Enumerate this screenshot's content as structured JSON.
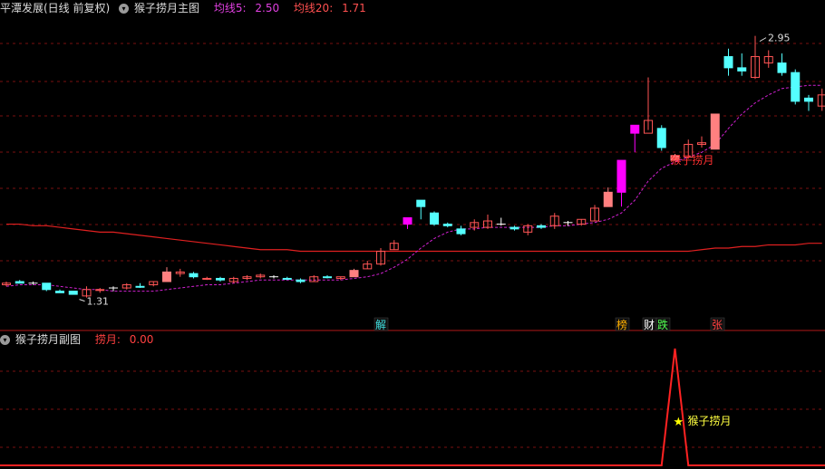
{
  "header_main": {
    "stock": "平潭发展(日线 前复权)",
    "indicator": "猴子捞月主图",
    "ma5_label": "均线5:",
    "ma5_value": "2.50",
    "ma20_label": "均线20:",
    "ma20_value": "1.71"
  },
  "header_sub": {
    "indicator": "猴子捞月副图",
    "value_label": "捞月:",
    "value": "0.00"
  },
  "colors": {
    "up_hollow": "#ff5555",
    "up_fill": "#ff8080",
    "down": "#54ffff",
    "limit_up": "#ff00ff",
    "ma5": "#d020d0",
    "ma20": "#e02020",
    "grid": "#7a1010",
    "signal": "#ff2222",
    "star": "#ffff00"
  },
  "chart_data": [
    {
      "type": "candlestick",
      "ylim": [
        1.2,
        3.05
      ],
      "candles": [
        {
          "o": 1.4,
          "h": 1.41,
          "l": 1.38,
          "c": 1.39,
          "t": "up"
        },
        {
          "o": 1.41,
          "h": 1.42,
          "l": 1.4,
          "c": 1.4,
          "t": "down"
        },
        {
          "o": 1.4,
          "h": 1.41,
          "l": 1.39,
          "c": 1.4,
          "t": "doji"
        },
        {
          "o": 1.4,
          "h": 1.4,
          "l": 1.35,
          "c": 1.36,
          "t": "down"
        },
        {
          "o": 1.35,
          "h": 1.36,
          "l": 1.34,
          "c": 1.34,
          "t": "down"
        },
        {
          "o": 1.35,
          "h": 1.35,
          "l": 1.33,
          "c": 1.33,
          "t": "down"
        },
        {
          "o": 1.32,
          "h": 1.38,
          "l": 1.31,
          "c": 1.36,
          "t": "up"
        },
        {
          "o": 1.36,
          "h": 1.37,
          "l": 1.34,
          "c": 1.36,
          "t": "up"
        },
        {
          "o": 1.37,
          "h": 1.38,
          "l": 1.35,
          "c": 1.37,
          "t": "doji"
        },
        {
          "o": 1.37,
          "h": 1.4,
          "l": 1.36,
          "c": 1.39,
          "t": "up"
        },
        {
          "o": 1.38,
          "h": 1.4,
          "l": 1.37,
          "c": 1.38,
          "t": "down"
        },
        {
          "o": 1.39,
          "h": 1.41,
          "l": 1.38,
          "c": 1.41,
          "t": "up"
        },
        {
          "o": 1.41,
          "h": 1.5,
          "l": 1.41,
          "c": 1.47,
          "t": "upfill"
        },
        {
          "o": 1.46,
          "h": 1.49,
          "l": 1.44,
          "c": 1.47,
          "t": "up"
        },
        {
          "o": 1.46,
          "h": 1.47,
          "l": 1.43,
          "c": 1.44,
          "t": "down"
        },
        {
          "o": 1.43,
          "h": 1.44,
          "l": 1.42,
          "c": 1.43,
          "t": "up"
        },
        {
          "o": 1.43,
          "h": 1.44,
          "l": 1.41,
          "c": 1.42,
          "t": "down"
        },
        {
          "o": 1.41,
          "h": 1.44,
          "l": 1.4,
          "c": 1.43,
          "t": "up"
        },
        {
          "o": 1.43,
          "h": 1.45,
          "l": 1.42,
          "c": 1.44,
          "t": "up"
        },
        {
          "o": 1.44,
          "h": 1.46,
          "l": 1.43,
          "c": 1.45,
          "t": "up"
        },
        {
          "o": 1.44,
          "h": 1.45,
          "l": 1.43,
          "c": 1.44,
          "t": "doji"
        },
        {
          "o": 1.43,
          "h": 1.44,
          "l": 1.42,
          "c": 1.43,
          "t": "down"
        },
        {
          "o": 1.42,
          "h": 1.43,
          "l": 1.4,
          "c": 1.41,
          "t": "down"
        },
        {
          "o": 1.41,
          "h": 1.45,
          "l": 1.41,
          "c": 1.44,
          "t": "up"
        },
        {
          "o": 1.44,
          "h": 1.45,
          "l": 1.43,
          "c": 1.44,
          "t": "down"
        },
        {
          "o": 1.43,
          "h": 1.44,
          "l": 1.42,
          "c": 1.44,
          "t": "up"
        },
        {
          "o": 1.44,
          "h": 1.49,
          "l": 1.44,
          "c": 1.48,
          "t": "upfill"
        },
        {
          "o": 1.49,
          "h": 1.54,
          "l": 1.49,
          "c": 1.52,
          "t": "up"
        },
        {
          "o": 1.52,
          "h": 1.62,
          "l": 1.51,
          "c": 1.6,
          "t": "up"
        },
        {
          "o": 1.61,
          "h": 1.67,
          "l": 1.61,
          "c": 1.65,
          "t": "up"
        },
        {
          "o": 1.77,
          "h": 1.81,
          "l": 1.74,
          "c": 1.81,
          "t": "limit"
        },
        {
          "o": 1.92,
          "h": 1.92,
          "l": 1.8,
          "c": 1.88,
          "t": "down"
        },
        {
          "o": 1.84,
          "h": 1.85,
          "l": 1.76,
          "c": 1.77,
          "t": "down"
        },
        {
          "o": 1.77,
          "h": 1.78,
          "l": 1.75,
          "c": 1.76,
          "t": "down"
        },
        {
          "o": 1.74,
          "h": 1.76,
          "l": 1.7,
          "c": 1.71,
          "t": "down"
        },
        {
          "o": 1.75,
          "h": 1.8,
          "l": 1.73,
          "c": 1.78,
          "t": "up"
        },
        {
          "o": 1.75,
          "h": 1.83,
          "l": 1.74,
          "c": 1.79,
          "t": "up"
        },
        {
          "o": 1.77,
          "h": 1.81,
          "l": 1.76,
          "c": 1.77,
          "t": "doji"
        },
        {
          "o": 1.75,
          "h": 1.76,
          "l": 1.73,
          "c": 1.74,
          "t": "down"
        },
        {
          "o": 1.72,
          "h": 1.77,
          "l": 1.7,
          "c": 1.76,
          "t": "up"
        },
        {
          "o": 1.76,
          "h": 1.77,
          "l": 1.74,
          "c": 1.75,
          "t": "down"
        },
        {
          "o": 1.76,
          "h": 1.84,
          "l": 1.74,
          "c": 1.82,
          "t": "up"
        },
        {
          "o": 1.77,
          "h": 1.79,
          "l": 1.76,
          "c": 1.78,
          "t": "doji"
        },
        {
          "o": 1.77,
          "h": 1.8,
          "l": 1.76,
          "c": 1.8,
          "t": "up"
        },
        {
          "o": 1.79,
          "h": 1.89,
          "l": 1.79,
          "c": 1.87,
          "t": "up"
        },
        {
          "o": 1.88,
          "h": 2.0,
          "l": 1.88,
          "c": 1.97,
          "t": "upfill"
        },
        {
          "o": 1.97,
          "h": 2.17,
          "l": 1.88,
          "c": 2.17,
          "t": "limit"
        },
        {
          "o": 2.34,
          "h": 2.34,
          "l": 2.22,
          "c": 2.39,
          "t": "limit"
        },
        {
          "o": 2.34,
          "h": 2.69,
          "l": 2.36,
          "c": 2.42,
          "t": "up"
        },
        {
          "o": 2.37,
          "h": 2.39,
          "l": 2.23,
          "c": 2.25,
          "t": "down"
        },
        {
          "o": 2.2,
          "h": 2.21,
          "l": 2.17,
          "c": 2.17,
          "t": "upfill"
        },
        {
          "o": 2.19,
          "h": 2.3,
          "l": 2.18,
          "c": 2.27,
          "t": "up"
        },
        {
          "o": 2.27,
          "h": 2.32,
          "l": 2.25,
          "c": 2.28,
          "t": "up"
        },
        {
          "o": 2.24,
          "h": 2.46,
          "l": 2.24,
          "c": 2.46,
          "t": "upfill"
        },
        {
          "o": 2.82,
          "h": 2.87,
          "l": 2.7,
          "c": 2.75,
          "t": "down"
        },
        {
          "o": 2.75,
          "h": 2.84,
          "l": 2.7,
          "c": 2.73,
          "t": "down"
        },
        {
          "o": 2.69,
          "h": 2.95,
          "l": 2.68,
          "c": 2.82,
          "t": "up"
        },
        {
          "o": 2.82,
          "h": 2.86,
          "l": 2.75,
          "c": 2.78,
          "t": "up"
        },
        {
          "o": 2.78,
          "h": 2.84,
          "l": 2.7,
          "c": 2.72,
          "t": "down"
        },
        {
          "o": 2.72,
          "h": 2.74,
          "l": 2.52,
          "c": 2.54,
          "t": "down"
        },
        {
          "o": 2.56,
          "h": 2.58,
          "l": 2.48,
          "c": 2.54,
          "t": "down"
        },
        {
          "o": 2.51,
          "h": 2.62,
          "l": 2.48,
          "c": 2.58,
          "t": "up"
        }
      ],
      "ma5": [
        1.38,
        1.39,
        1.39,
        1.39,
        1.38,
        1.37,
        1.36,
        1.36,
        1.35,
        1.35,
        1.35,
        1.35,
        1.36,
        1.37,
        1.38,
        1.39,
        1.39,
        1.4,
        1.41,
        1.42,
        1.42,
        1.42,
        1.42,
        1.42,
        1.42,
        1.42,
        1.43,
        1.44,
        1.46,
        1.5,
        1.55,
        1.62,
        1.68,
        1.72,
        1.74,
        1.74,
        1.75,
        1.75,
        1.75,
        1.75,
        1.75,
        1.76,
        1.76,
        1.77,
        1.78,
        1.8,
        1.84,
        1.92,
        2.04,
        2.12,
        2.16,
        2.19,
        2.22,
        2.27,
        2.37,
        2.46,
        2.53,
        2.58,
        2.62,
        2.63,
        2.64,
        2.64
      ],
      "ma20": [
        1.77,
        1.77,
        1.76,
        1.76,
        1.75,
        1.74,
        1.73,
        1.72,
        1.72,
        1.71,
        1.7,
        1.69,
        1.68,
        1.67,
        1.66,
        1.65,
        1.64,
        1.63,
        1.62,
        1.61,
        1.61,
        1.61,
        1.6,
        1.6,
        1.6,
        1.6,
        1.6,
        1.6,
        1.6,
        1.6,
        1.6,
        1.6,
        1.6,
        1.6,
        1.6,
        1.6,
        1.6,
        1.6,
        1.6,
        1.6,
        1.6,
        1.6,
        1.6,
        1.6,
        1.6,
        1.6,
        1.6,
        1.6,
        1.6,
        1.6,
        1.6,
        1.6,
        1.61,
        1.62,
        1.62,
        1.63,
        1.63,
        1.64,
        1.64,
        1.64,
        1.65,
        1.65
      ],
      "annotations": [
        {
          "index": 56,
          "price": 2.95,
          "label": "2.95"
        },
        {
          "index": 6,
          "price": 1.31,
          "label": "1.31"
        },
        {
          "index": 50,
          "text": "猴子捞月"
        }
      ],
      "event_markers": [
        {
          "index": 28,
          "text": "解"
        },
        {
          "index": 45,
          "text": "榜"
        },
        {
          "index": 47,
          "text": "财"
        },
        {
          "index": 48,
          "text": "跌"
        },
        {
          "index": 53,
          "text": "张"
        }
      ]
    },
    {
      "type": "line",
      "series": [
        {
          "values": [
            0,
            0,
            0,
            0,
            0,
            0,
            0,
            0,
            0,
            0,
            0,
            0,
            0,
            0,
            0,
            0,
            0,
            0,
            0,
            0,
            0,
            0,
            0,
            0,
            0,
            0,
            0,
            0,
            0,
            0,
            0,
            0,
            0,
            0,
            0,
            0,
            0,
            0,
            0,
            0,
            0,
            0,
            0,
            0,
            0,
            0,
            0,
            0,
            0,
            0,
            1,
            0,
            0,
            0,
            0,
            0,
            0,
            0,
            0,
            0,
            0,
            0
          ]
        }
      ],
      "signal_label": "猴子捞月"
    }
  ]
}
